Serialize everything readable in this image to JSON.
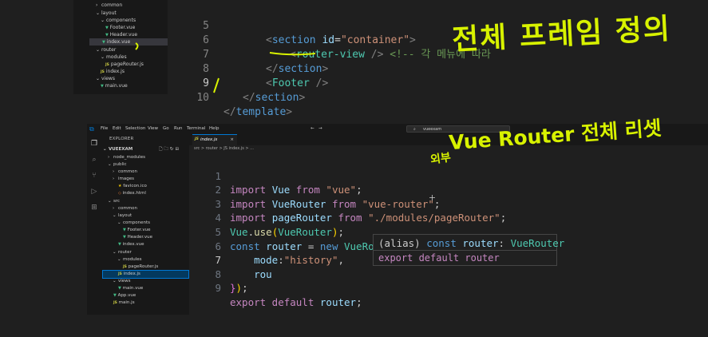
{
  "colors": {
    "accent": "#0078d4",
    "annotation": "#d8f200",
    "background": "#1f1f1f",
    "sidebar": "#181818"
  },
  "top_sidebar": {
    "items": [
      "common",
      "layout",
      "components",
      "Footer.vue",
      "Header.vue",
      "index.vue",
      "router",
      "modules",
      "pageRouter.js",
      "index.js",
      "views",
      "main.vue"
    ]
  },
  "top_editor": {
    "lines": [
      {
        "num": "5",
        "text": "<section id=\"container\">"
      },
      {
        "num": "6",
        "text": "<router-view /> <!-- 각 메뉴에 따라"
      },
      {
        "num": "7",
        "text": "</section>"
      },
      {
        "num": "8",
        "text": "<Footer />"
      },
      {
        "num": "9",
        "text": "</section>"
      },
      {
        "num": "10",
        "text": "</template>"
      }
    ],
    "tokens": {
      "l5_open": "<",
      "l5_tag": "section",
      "l5_attr": " id",
      "l5_eq": "=",
      "l5_val": "\"container\"",
      "l5_close": ">",
      "l6_open": "<",
      "l6_tag": "router-view",
      "l6_close": " />",
      "l6_cmt": " <!-- 각 메뉴에 따라",
      "l7_open": "</",
      "l7_tag": "section",
      "l7_close": ">",
      "l8_open": "<",
      "l8_tag": "Footer",
      "l8_close": " />",
      "l9_open": "</",
      "l9_tag": "section",
      "l9_close": ">",
      "l10_open": "</",
      "l10_tag": "template",
      "l10_close": ">"
    },
    "annotation": "전체 프레임 정의"
  },
  "titlebar": {
    "menus": [
      "File",
      "Edit",
      "Selection",
      "View",
      "Go",
      "Run",
      "Terminal",
      "Help"
    ],
    "search": "vueexam"
  },
  "explorer": {
    "header": "EXPLORER",
    "root": "VUEEXAM",
    "items": [
      "node_modules",
      "public",
      "common",
      "images",
      "favicon.ico",
      "index.html",
      "src",
      "common",
      "layout",
      "components",
      "Footer.vue",
      "Header.vue",
      "index.vue",
      "router",
      "modules",
      "pageRouter.js",
      "index.js",
      "views",
      "main.vue",
      "App.vue",
      "main.js"
    ]
  },
  "tab": {
    "label": "index.js",
    "close": "×"
  },
  "breadcrumb": "src > router > JS index.js > ...",
  "code_lines": [
    {
      "num": "1",
      "text": "import Vue from \"vue\";"
    },
    {
      "num": "2",
      "text": "import VueRouter from \"vue-router\";"
    },
    {
      "num": "3",
      "text": "import pageRouter from \"./modules/pageRouter\";"
    },
    {
      "num": "4",
      "text": "Vue.use(VueRouter);"
    },
    {
      "num": "5",
      "text": "const router = new VueRouter({"
    },
    {
      "num": "6",
      "text": "    mode:\"history\","
    },
    {
      "num": "7",
      "text": "    rou"
    },
    {
      "num": "8",
      "text": "});"
    },
    {
      "num": "9",
      "text": "export default router;"
    }
  ],
  "tokens": {
    "import": "import",
    "space": " ",
    "vue": "Vue",
    "from": " from ",
    "vue_str": "\"vue\"",
    "semi": ";",
    "vuerouter": "VueRouter",
    "vuerouter_str": "\"vue-router\"",
    "pagerouter": "pageRouter",
    "pagerouter_str": "\"./modules/pageRouter\"",
    "vue_obj": "Vue",
    "dot": ".",
    "use": "use",
    "paren_open": "(",
    "paren_close": ")",
    "const": "const",
    "router": " router",
    "eq": " = ",
    "new": "new",
    "vuerouter_cls": " VueRouter",
    "brace_open": "{",
    "brace_close": "}",
    "indent": "    ",
    "mode": "mode",
    "colon": ":",
    "history_str": "\"history\"",
    "comma": ",",
    "rou": "rou",
    "export": "export",
    "default": " default",
    "router_end": " router"
  },
  "hover": {
    "alias": "(alias)",
    "const_kw": " const",
    "name": " router",
    "colon": ": ",
    "type": "VueRouter",
    "doc": "export default router"
  },
  "annotations": {
    "router_title": "Vue Router 전체 리셋",
    "arrow_note": "외부"
  }
}
